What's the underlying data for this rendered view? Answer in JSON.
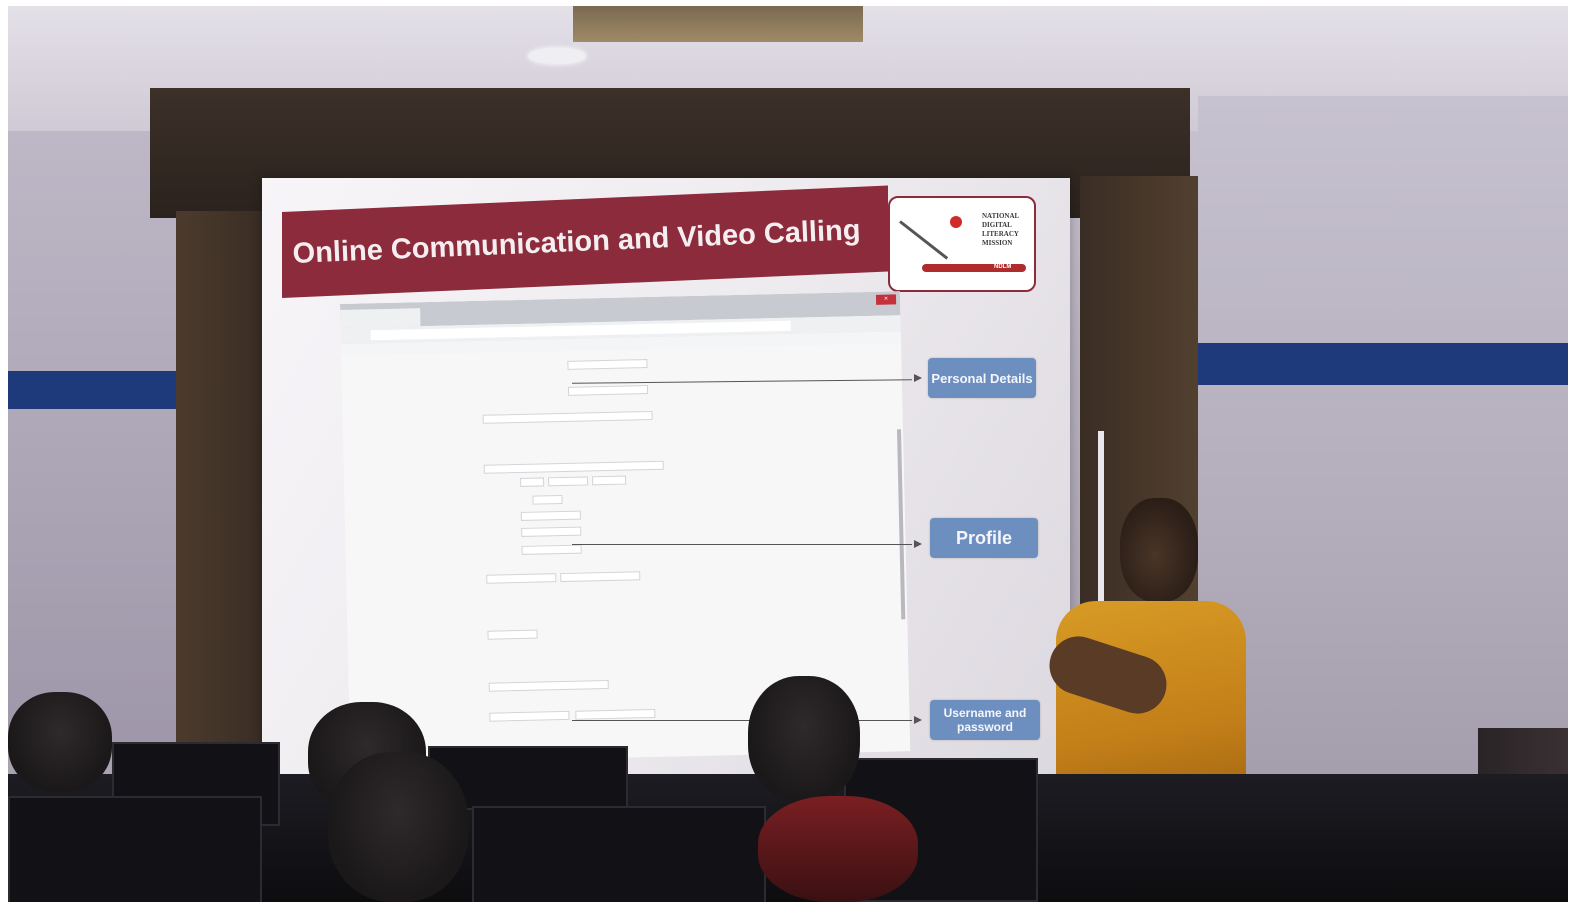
{
  "slide": {
    "title": "Online Communication and Video Calling",
    "logo": {
      "lines": [
        "NATIONAL",
        "DIGITAL",
        "LITERACY",
        "MISSION"
      ],
      "band_label": "NDLM"
    },
    "browser": {
      "close_label": "×"
    },
    "callouts": [
      {
        "label": "Personal Details"
      },
      {
        "label": "Profile"
      },
      {
        "label": "Username and password"
      }
    ]
  }
}
